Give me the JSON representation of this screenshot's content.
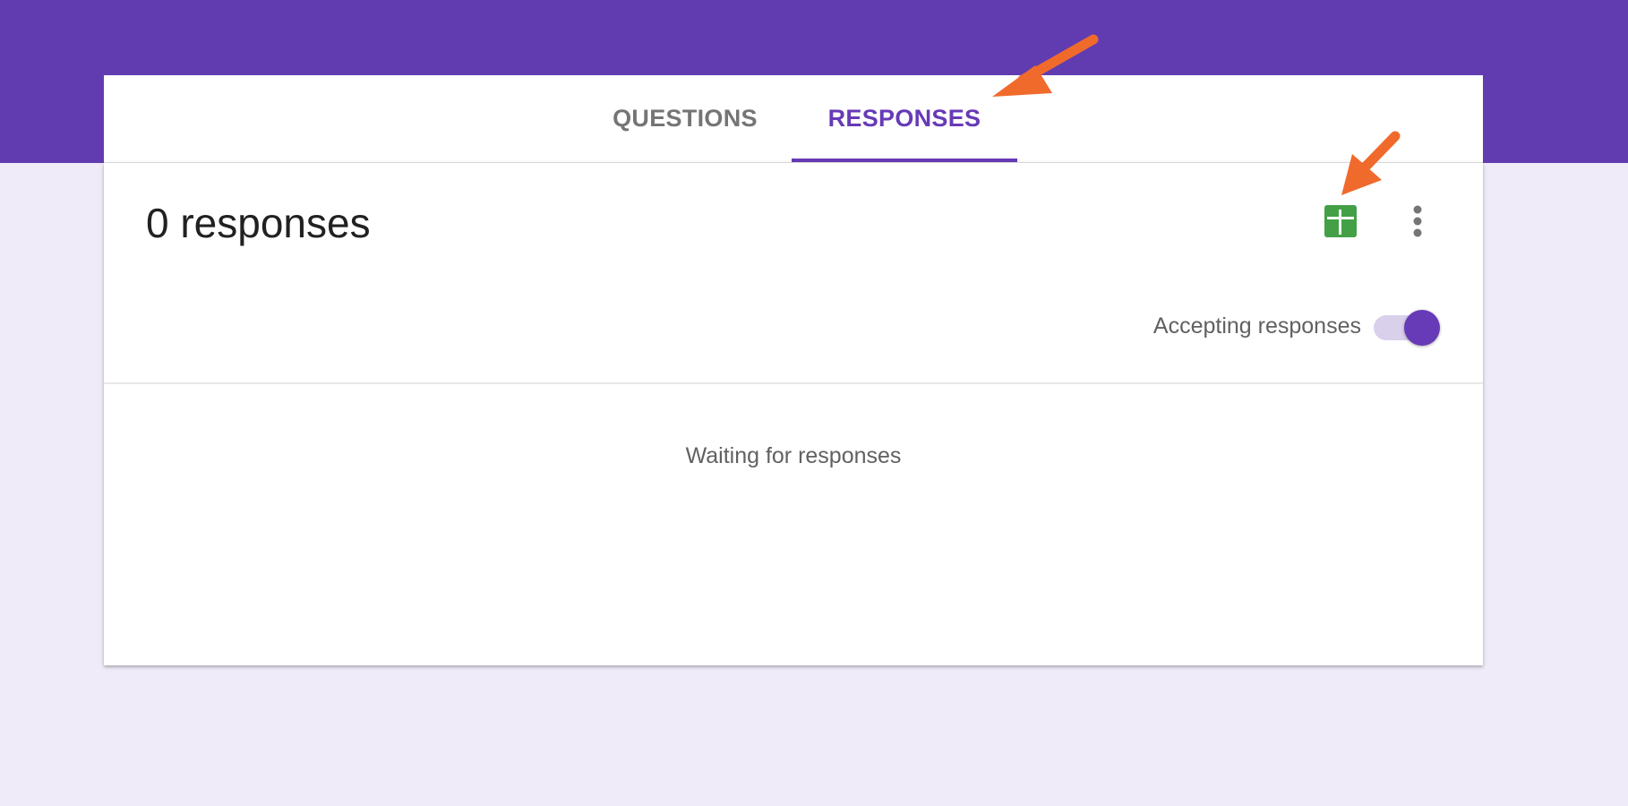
{
  "tabs": {
    "questions_label": "QUESTIONS",
    "responses_label": "RESPONSES",
    "active": "RESPONSES"
  },
  "summary": {
    "title": "0 responses",
    "accepting_label": "Accepting responses",
    "accepting_enabled": true
  },
  "empty_state": {
    "message": "Waiting for responses"
  },
  "toolbar": {
    "sheets_icon": "spreadsheet-add-icon",
    "more_icon": "more-vert-icon"
  },
  "colors": {
    "brand": "#613cb1",
    "accent": "#673ab7",
    "sheets_green": "#43a047",
    "annotation_arrow": "#f06a2c",
    "page_background": "#efebf8"
  }
}
